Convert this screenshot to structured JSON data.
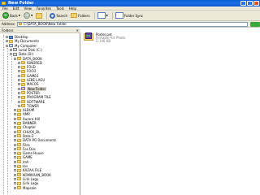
{
  "window": {
    "title": "New Folder"
  },
  "menu": [
    "File",
    "Edit",
    "View",
    "Favorites",
    "Tools",
    "Help"
  ],
  "toolbar": {
    "back": "Back",
    "search": "Search",
    "folders": "Folders",
    "folder_sync": "Folder Sync"
  },
  "address": {
    "label": "Address",
    "value": "C:\\DATA_BOOK\\New Folder",
    "go": "Go"
  },
  "tree": {
    "header": "Folders",
    "items": [
      {
        "label": "Desktop",
        "icon": "desktop"
      },
      {
        "label": "My Documents",
        "icon": "folder"
      },
      {
        "label": "My Computer",
        "icon": "computer"
      },
      {
        "label": "Local Disk (C:)",
        "icon": "drive"
      },
      {
        "label": "Data (D:)",
        "icon": "drive"
      },
      {
        "label": "DATA_BOOK",
        "icon": "folder"
      },
      {
        "label": "IGNORED",
        "icon": "folder"
      },
      {
        "label": "FOLD",
        "icon": "folder"
      },
      {
        "label": "FOCO",
        "icon": "folder"
      },
      {
        "label": "GAMES",
        "icon": "folder"
      },
      {
        "label": "LEBE LAGU",
        "icon": "folder"
      },
      {
        "label": "MACOS",
        "icon": "folder"
      },
      {
        "label": "New Folder",
        "icon": "folder",
        "selected": true
      },
      {
        "label": "POSTER",
        "icon": "folder"
      },
      {
        "label": "PROGRAM FILE",
        "icon": "folder"
      },
      {
        "label": "SOFTWARE",
        "icon": "folder"
      },
      {
        "label": "TOWER",
        "icon": "folder"
      },
      {
        "label": "ALBUM",
        "icon": "folder"
      },
      {
        "label": "AMR",
        "icon": "folder"
      },
      {
        "label": "Aurora Hill",
        "icon": "folder"
      },
      {
        "label": "BANNER",
        "icon": "folder"
      },
      {
        "label": "Chapter",
        "icon": "folder"
      },
      {
        "label": "CHUCK_DL",
        "icon": "folder"
      },
      {
        "label": "Data-2",
        "icon": "folder"
      },
      {
        "label": "DATA PO Documents",
        "icon": "folder"
      },
      {
        "label": "Files",
        "icon": "folder"
      },
      {
        "label": "Fox Doc",
        "icon": "folder"
      },
      {
        "label": "Game House",
        "icon": "folder"
      },
      {
        "label": "GAME",
        "icon": "folder"
      },
      {
        "label": "lmh",
        "icon": "folder"
      },
      {
        "label": "lon",
        "icon": "folder"
      },
      {
        "label": "KAZAA FILE",
        "icon": "folder"
      },
      {
        "label": "KOMIKAAN_BOOK",
        "icon": "folder"
      },
      {
        "label": "Lirik Lagu",
        "icon": "folder"
      },
      {
        "label": "Lirik Lagu",
        "icon": "folder"
      },
      {
        "label": "Mapsale",
        "icon": "folder"
      }
    ]
  },
  "files": [
    {
      "name": "Poster.pxt",
      "type": "Portable Art Photo",
      "size": "2,146 KB"
    }
  ]
}
